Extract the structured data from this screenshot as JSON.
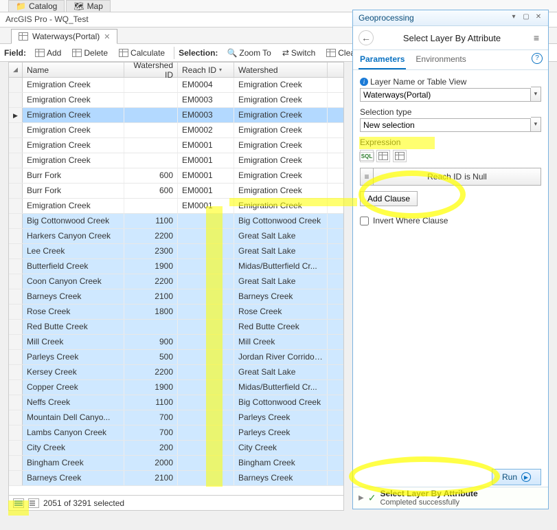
{
  "toptabs": {
    "catalog": "Catalog",
    "map": "Map"
  },
  "title": "ArcGIS Pro - WQ_Test",
  "table_tab": "Waterways(Portal)",
  "toolbar": {
    "field_lbl": "Field:",
    "add": "Add",
    "delete": "Delete",
    "calculate": "Calculate",
    "selection_lbl": "Selection:",
    "zoom": "Zoom To",
    "switch": "Switch",
    "clear": "Clea"
  },
  "columns": {
    "name": "Name",
    "wid": "Watershed ID",
    "rid": "Reach ID",
    "ws": "Watershed"
  },
  "rows": [
    {
      "name": "Emigration Creek",
      "wid": "<Null>",
      "rid": "EM0004",
      "ws": "Emigration Creek",
      "sel": false
    },
    {
      "name": "Emigration Creek",
      "wid": "<Null>",
      "rid": "EM0003",
      "ws": "Emigration Creek",
      "sel": false
    },
    {
      "name": "Emigration Creek",
      "wid": "<Null>",
      "rid": "EM0003",
      "ws": "Emigration Creek",
      "sel": true
    },
    {
      "name": "Emigration Creek",
      "wid": "<Null>",
      "rid": "EM0002",
      "ws": "Emigration Creek",
      "sel": false
    },
    {
      "name": "Emigration Creek",
      "wid": "<Null>",
      "rid": "EM0001",
      "ws": "Emigration Creek",
      "sel": false
    },
    {
      "name": "Emigration Creek",
      "wid": "<Null>",
      "rid": "EM0001",
      "ws": "Emigration Creek",
      "sel": false
    },
    {
      "name": "Burr Fork",
      "wid": "600",
      "rid": "EM0001",
      "ws": "Emigration Creek",
      "sel": false
    },
    {
      "name": "Burr Fork",
      "wid": "600",
      "rid": "EM0001",
      "ws": "Emigration Creek",
      "sel": false
    },
    {
      "name": "Emigration Creek",
      "wid": "<Null>",
      "rid": "EM0001",
      "ws": "Emigration Creek",
      "sel": false
    },
    {
      "name": "Big Cottonwood Creek",
      "wid": "1100",
      "rid": "<Null>",
      "ws": "Big Cottonwood Creek",
      "sel": true
    },
    {
      "name": "Harkers Canyon Creek",
      "wid": "2200",
      "rid": "<Null>",
      "ws": "Great Salt Lake",
      "sel": true
    },
    {
      "name": "Lee Creek",
      "wid": "2300",
      "rid": "<Null>",
      "ws": "Great Salt Lake",
      "sel": true
    },
    {
      "name": "Butterfield Creek",
      "wid": "1900",
      "rid": "<Null>",
      "ws": "Midas/Butterfield Cr...",
      "sel": true
    },
    {
      "name": "Coon Canyon Creek",
      "wid": "2200",
      "rid": "<Null>",
      "ws": "Great Salt Lake",
      "sel": true
    },
    {
      "name": "Barneys Creek",
      "wid": "2100",
      "rid": "<Null>",
      "ws": "Barneys Creek",
      "sel": true
    },
    {
      "name": "Rose Creek",
      "wid": "1800",
      "rid": "<Null>",
      "ws": "Rose Creek",
      "sel": true
    },
    {
      "name": "Red Butte Creek",
      "wid": "<Null>",
      "rid": "<Null>",
      "ws": "Red Butte Creek",
      "sel": true
    },
    {
      "name": "Mill Creek",
      "wid": "900",
      "rid": "<Null>",
      "ws": "Mill Creek",
      "sel": true
    },
    {
      "name": "Parleys Creek",
      "wid": "500",
      "rid": "<Null>",
      "ws": "Jordan River Corridor...",
      "sel": true
    },
    {
      "name": "Kersey Creek",
      "wid": "2200",
      "rid": "<Null>",
      "ws": "Great Salt Lake",
      "sel": true
    },
    {
      "name": "Copper Creek",
      "wid": "1900",
      "rid": "<Null>",
      "ws": "Midas/Butterfield Cr...",
      "sel": true
    },
    {
      "name": "Neffs Creek",
      "wid": "1100",
      "rid": "<Null>",
      "ws": "Big Cottonwood Creek",
      "sel": true
    },
    {
      "name": "Mountain Dell Canyo...",
      "wid": "700",
      "rid": "<Null>",
      "ws": "Parleys Creek",
      "sel": true
    },
    {
      "name": "Lambs Canyon Creek",
      "wid": "700",
      "rid": "<Null>",
      "ws": "Parleys Creek",
      "sel": true
    },
    {
      "name": "City Creek",
      "wid": "200",
      "rid": "<Null>",
      "ws": "City Creek",
      "sel": true
    },
    {
      "name": "Bingham Creek",
      "wid": "2000",
      "rid": "<Null>",
      "ws": "Bingham Creek",
      "sel": true
    },
    {
      "name": "Barneys Creek",
      "wid": "2100",
      "rid": "<Null>",
      "ws": "Barneys Creek",
      "sel": true
    }
  ],
  "status": "2051 of 3291 selected",
  "gp": {
    "title": "Geoprocessing",
    "tool": "Select Layer By Attribute",
    "tab_params": "Parameters",
    "tab_env": "Environments",
    "lbl_layer": "Layer Name or Table View",
    "val_layer": "Waterways(Portal)",
    "lbl_seltype": "Selection type",
    "val_seltype": "New selection",
    "lbl_expr": "Expression",
    "clause_field": "Reach ID",
    "clause_op": "is Null",
    "add_clause": "Add Clause",
    "invert": "Invert Where Clause",
    "run": "Run",
    "result_title": "Select Layer By Attribute",
    "result_msg": "Completed successfully"
  }
}
